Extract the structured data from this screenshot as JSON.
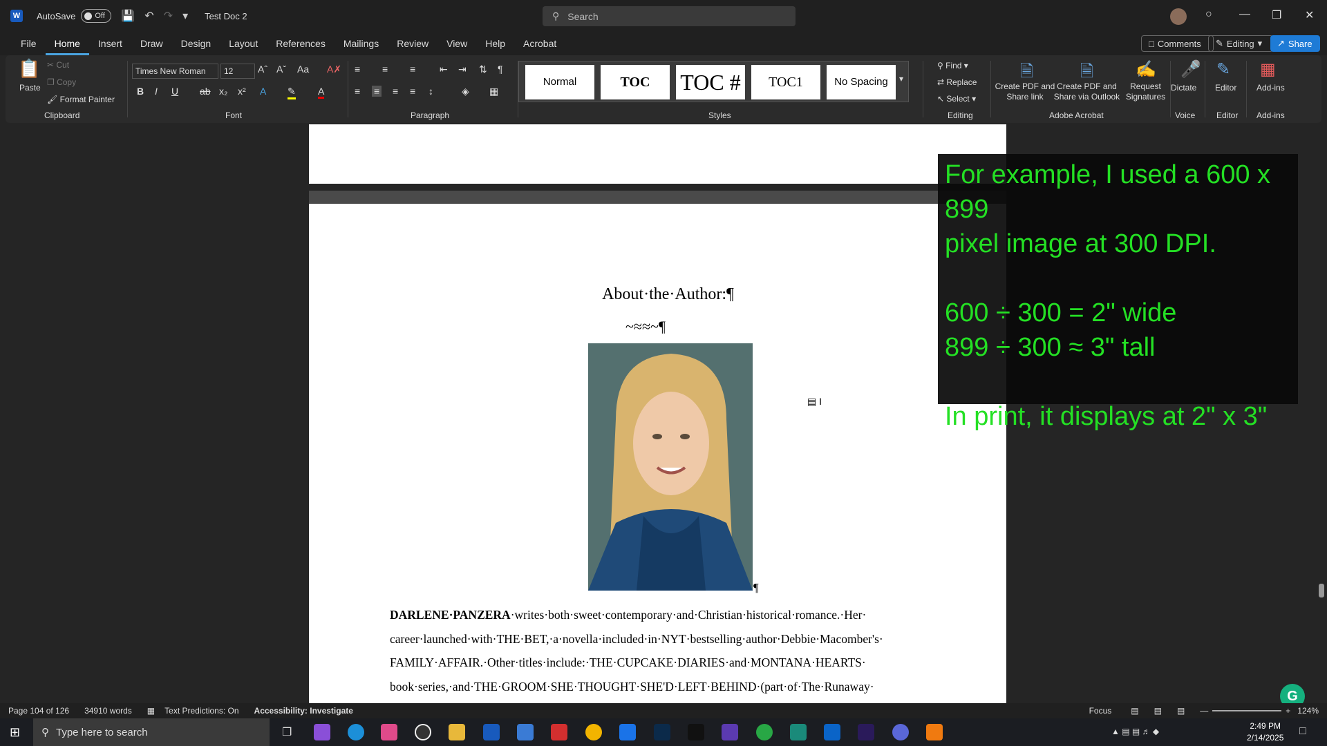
{
  "titlebar": {
    "app_icon": "W",
    "autosave_label": "AutoSave",
    "autosave_state": "Off",
    "doc_name": "Test Doc 2",
    "search_placeholder": "Search"
  },
  "menu": {
    "tabs": [
      "File",
      "Home",
      "Insert",
      "Draw",
      "Design",
      "Layout",
      "References",
      "Mailings",
      "Review",
      "View",
      "Help",
      "Acrobat"
    ],
    "active": "Home",
    "comments_label": "Comments",
    "editing_label": "Editing",
    "share_label": "Share"
  },
  "ribbon": {
    "clipboard": {
      "paste": "Paste",
      "cut": "Cut",
      "copy": "Copy",
      "format_painter": "Format Painter",
      "label": "Clipboard"
    },
    "font": {
      "name": "Times New Roman",
      "size": "12",
      "label": "Font"
    },
    "paragraph": {
      "label": "Paragraph"
    },
    "styles": {
      "items": [
        "Normal",
        "TOC",
        "TOC #",
        "TOC1",
        "No Spacing"
      ],
      "label": "Styles"
    },
    "editing": {
      "find": "Find",
      "replace": "Replace",
      "select": "Select",
      "label": "Editing"
    },
    "acrobat": {
      "create_pdf_share": "Create PDF and Share link",
      "create_pdf_outlook": "Create PDF and Share via Outlook",
      "request_signatures": "Request Signatures",
      "label": "Adobe Acrobat"
    },
    "voice": {
      "dictate": "Dictate",
      "label": "Voice"
    },
    "editor": {
      "editor": "Editor",
      "label": "Editor"
    },
    "addins": {
      "addins": "Add-ins",
      "label": "Add-ins"
    }
  },
  "document": {
    "title": "About·the·Author:¶",
    "ornament": "~≈≈~¶",
    "paragraph": "DARLENE·PANZERA·writes·both·sweet·contemporary·and·Christian·historical·romance.·Her· career·launched·with·THE·BET,·a·novella·included·in·NYT·bestselling·author·Debbie·Macomber's· FAMILY·AFFAIR.·Other·titles·include:·THE·CUPCAKE·DIARIES·and·MONTANA·HEARTS· book·series,·and·THE·GROOM·SHE·THOUGHT·SHE'D·LEFT·BEHIND·(part·of·The·Runaway·",
    "para_bold_lead": "DARLENE·PANZERA"
  },
  "overlay": {
    "lines": [
      "For example, I used a 600 x 899",
      "pixel image at 300 DPI.",
      "",
      "600 ÷ 300 = 2\" wide",
      "899 ÷ 300 ≈ 3\" tall",
      "",
      "In print, it displays at 2\" x 3\""
    ],
    "color": "#24e024"
  },
  "status": {
    "page": "Page 104 of 126",
    "words": "34910 words",
    "predictions": "Text Predictions: On",
    "accessibility": "Accessibility: Investigate",
    "focus": "Focus",
    "zoom": "124%"
  },
  "taskbar": {
    "search_placeholder": "Type here to search",
    "time": "2:49 PM",
    "date": "2/14/2025"
  }
}
